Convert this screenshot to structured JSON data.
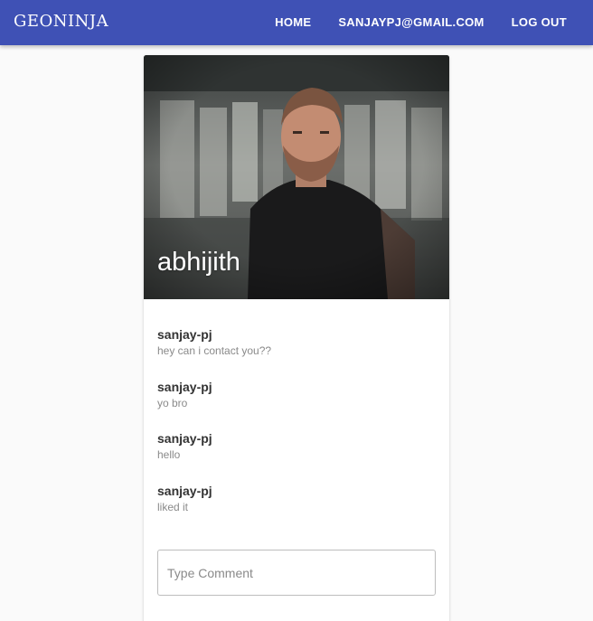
{
  "navbar": {
    "brand": "GEONINJA",
    "links": [
      {
        "label": "HOME"
      },
      {
        "label": "SANJAYPJ@GMAIL.COM"
      },
      {
        "label": "LOG OUT"
      }
    ],
    "color": "#3f51b5"
  },
  "profile": {
    "name": "abhijith",
    "photo_icon": "profile-photo"
  },
  "comments": [
    {
      "author": "sanjay-pj",
      "text": "hey can i contact you??"
    },
    {
      "author": "sanjay-pj",
      "text": "yo bro"
    },
    {
      "author": "sanjay-pj",
      "text": "hello"
    },
    {
      "author": "sanjay-pj",
      "text": "liked it"
    }
  ],
  "comment_input": {
    "placeholder": "Type Comment",
    "value": ""
  }
}
